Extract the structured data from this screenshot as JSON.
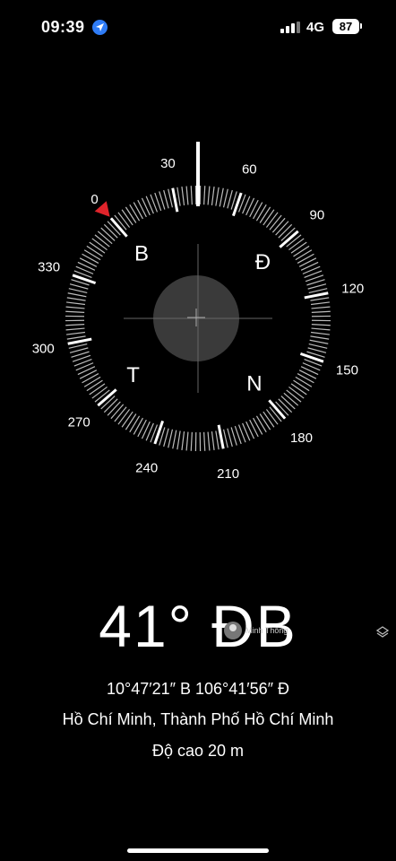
{
  "status_bar": {
    "time": "09:39",
    "location_icon": "location-arrow-icon",
    "signal_icon": "cellular-signal-icon",
    "network": "4G",
    "battery": "87"
  },
  "compass": {
    "degree_labels": [
      "0",
      "30",
      "60",
      "90",
      "120",
      "150",
      "180",
      "210",
      "240",
      "270",
      "300",
      "330"
    ],
    "cardinals": {
      "north": "B",
      "east": "Đ",
      "south": "N",
      "west": "T"
    },
    "heading_degrees": 41,
    "marker_color": "#e0242b"
  },
  "heading": {
    "degrees": "41°",
    "direction": "ĐB"
  },
  "watermark": {
    "name": "Minh Thông"
  },
  "coordinates": "10°47′21″ B  106°41′56″ Đ",
  "location": "Hồ Chí Minh, Thành Phố Hồ Chí Minh",
  "altitude": "Độ cao 20 m"
}
